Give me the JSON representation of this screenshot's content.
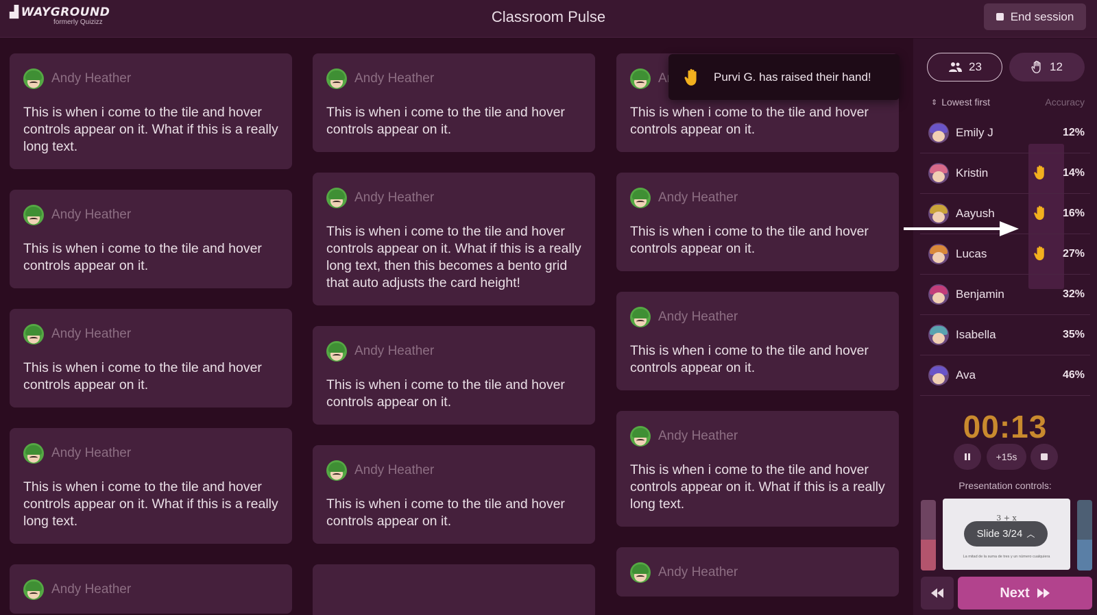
{
  "header": {
    "brand": "WAYGROUND",
    "brand_sub": "formerly Quizizz",
    "title": "Classroom Pulse",
    "end_session_label": "End session"
  },
  "toast": {
    "message": "Purvi G. has raised their hand!"
  },
  "board": {
    "columns": [
      [
        {
          "author": "Andy Heather",
          "text": "This is when i come to the tile and hover controls appear on it. What if this is a really long text."
        },
        {
          "author": "Andy Heather",
          "text": "This is when i come to the tile and hover controls appear on it."
        },
        {
          "author": "Andy Heather",
          "text": "This is when i come to the tile and hover controls appear on it."
        },
        {
          "author": "Andy Heather",
          "text": "This is when i come to the tile and hover controls appear on it. What if this is a really long text."
        },
        {
          "author": "Andy Heather",
          "text": ""
        }
      ],
      [
        {
          "author": "Andy Heather",
          "text": "This is when i come to the tile and hover controls appear on it."
        },
        {
          "author": "Andy Heather",
          "text": "This is when i come to the tile and hover controls appear on it. What if this is a really long text, then this becomes a bento grid that auto adjusts the card height!"
        },
        {
          "author": "Andy Heather",
          "text": "This is when i come to the tile and hover controls appear on it."
        },
        {
          "author": "Andy Heather",
          "text": "This is when i come to the tile and hover controls appear on it."
        },
        {
          "author": "",
          "text": ""
        }
      ],
      [
        {
          "author": "Andy Heather",
          "text": "This is when i come to the tile and hover controls appear on it."
        },
        {
          "author": "Andy Heather",
          "text": "This is when i come to the tile and hover controls appear on it."
        },
        {
          "author": "Andy Heather",
          "text": "This is when i come to the tile and hover controls appear on it."
        },
        {
          "author": "Andy Heather",
          "text": "This is when i come to the tile and hover controls appear on it. What if this is a really long text."
        },
        {
          "author": "Andy Heather",
          "text": ""
        }
      ]
    ]
  },
  "panel": {
    "students_count": "23",
    "hands_count": "12",
    "sort_label": "Lowest first",
    "accuracy_label": "Accuracy",
    "students": [
      {
        "name": "Emily J",
        "pct": "12%",
        "hand": false,
        "cap_color": "#6a55c8"
      },
      {
        "name": "Kristin",
        "pct": "14%",
        "hand": true,
        "cap_color": "#d86a8a"
      },
      {
        "name": "Aayush",
        "pct": "16%",
        "hand": true,
        "cap_color": "#c9a33a"
      },
      {
        "name": "Lucas",
        "pct": "27%",
        "hand": true,
        "cap_color": "#d9893a"
      },
      {
        "name": "Benjamin",
        "pct": "32%",
        "hand": false,
        "cap_color": "#c23d7a"
      },
      {
        "name": "Isabella",
        "pct": "35%",
        "hand": false,
        "cap_color": "#5aa3b0"
      },
      {
        "name": "Ava",
        "pct": "46%",
        "hand": false,
        "cap_color": "#6a55c8"
      }
    ],
    "timer": "00:13",
    "add_time_label": "+15s",
    "presentation_label": "Presentation controls:",
    "slide_label": "Slide 3/24",
    "slide_formula": "3 + x",
    "slide_caption": "La mitad de la suma de tres y un número cualquiera",
    "next_label": "Next"
  },
  "colors": {
    "accent": "#b2438d",
    "timer": "#c98a2e",
    "hand": "#f2b01e"
  }
}
